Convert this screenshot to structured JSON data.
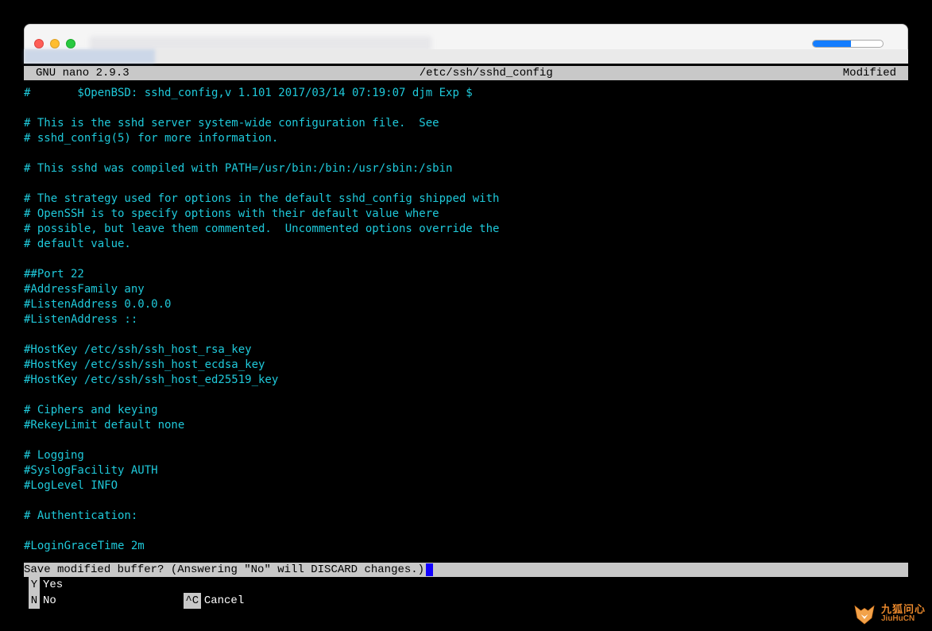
{
  "nano_header": {
    "left": "GNU nano 2.9.3",
    "center": "/etc/ssh/sshd_config",
    "right": "Modified"
  },
  "file_lines": [
    "#       $OpenBSD: sshd_config,v 1.101 2017/03/14 07:19:07 djm Exp $",
    "",
    "# This is the sshd server system-wide configuration file.  See",
    "# sshd_config(5) for more information.",
    "",
    "# This sshd was compiled with PATH=/usr/bin:/bin:/usr/sbin:/sbin",
    "",
    "# The strategy used for options in the default sshd_config shipped with",
    "# OpenSSH is to specify options with their default value where",
    "# possible, but leave them commented.  Uncommented options override the",
    "# default value.",
    "",
    "##Port 22",
    "#AddressFamily any",
    "#ListenAddress 0.0.0.0",
    "#ListenAddress ::",
    "",
    "#HostKey /etc/ssh/ssh_host_rsa_key",
    "#HostKey /etc/ssh/ssh_host_ecdsa_key",
    "#HostKey /etc/ssh/ssh_host_ed25519_key",
    "",
    "# Ciphers and keying",
    "#RekeyLimit default none",
    "",
    "# Logging",
    "#SyslogFacility AUTH",
    "#LogLevel INFO",
    "",
    "# Authentication:",
    "",
    "#LoginGraceTime 2m"
  ],
  "prompt": {
    "text": "Save modified buffer?  (Answering \"No\" will DISCARD changes.) "
  },
  "options": {
    "yes_key": " Y",
    "yes_label": "Yes",
    "no_key": " N",
    "no_label": "No",
    "cancel_key": "^C",
    "cancel_label": "Cancel"
  },
  "watermark": {
    "cn": "九狐问心",
    "en": "JiuHuCN"
  },
  "colors": {
    "text_cyan": "#1fc9da",
    "header_bg": "#c8c8c8",
    "progress_blue": "#147dff",
    "cursor_blue": "#1200ff",
    "watermark_orange": "#e8872b"
  }
}
